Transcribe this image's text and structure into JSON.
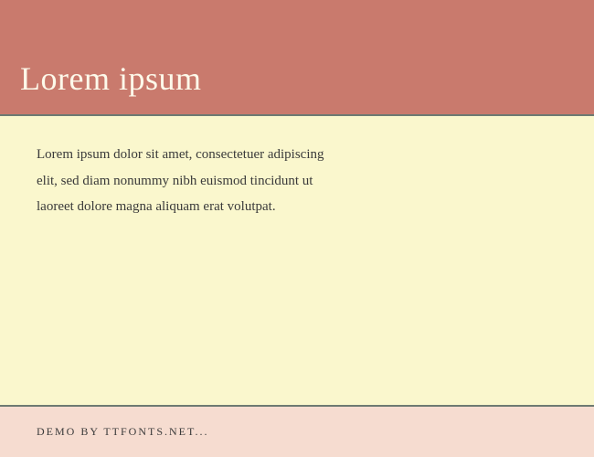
{
  "header": {
    "title": "Lorem ipsum"
  },
  "main": {
    "body": "Lorem ipsum dolor sit amet, consectetuer adipiscing elit, sed diam nonummy nibh euismod tincidunt ut laoreet dolore magna aliquam erat volutpat."
  },
  "footer": {
    "text": "DEMO BY TTFONTS.NET..."
  },
  "colors": {
    "header_bg": "#c97a6d",
    "main_bg": "#faf7cd",
    "footer_bg": "#f6dcd0",
    "divider": "#6d7a72",
    "title_color": "#fdf9ea"
  }
}
